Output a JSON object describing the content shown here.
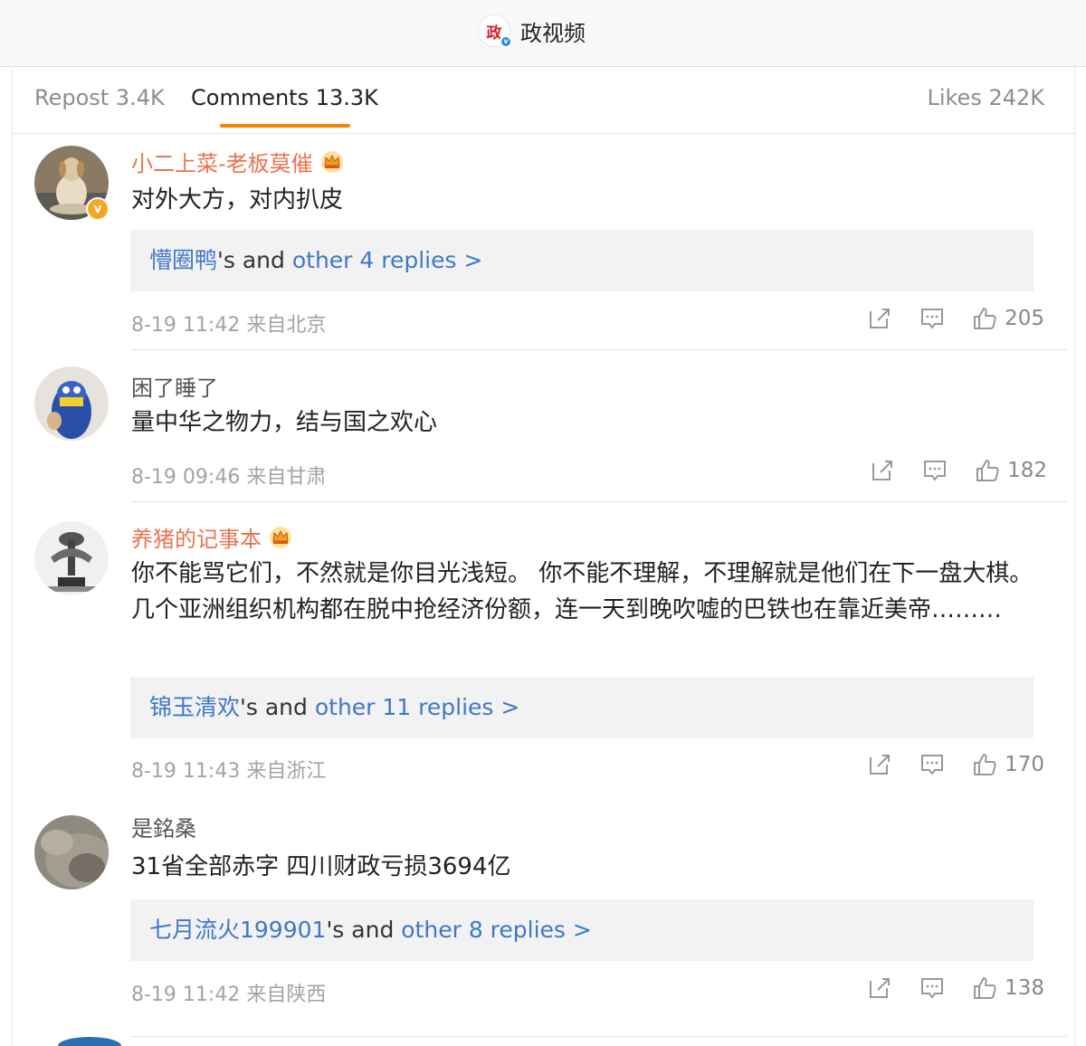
{
  "header": {
    "logo_glyph": "政",
    "account_name": "政视频",
    "verified_mark": "v",
    "brand_color": "#d6202b"
  },
  "tabs": [
    {
      "label": "Repost 3.4K"
    },
    {
      "label": "Comments 13.3K"
    },
    {
      "label": "Likes 242K"
    }
  ],
  "accent_color": "#ff8200",
  "link_color": "#3f78c8",
  "comments": [
    {
      "username": "小二上菜-老板莫催",
      "username_style": "vip-orange",
      "verified": true,
      "verified_mark": "v",
      "text": "对外大方，对内扒皮",
      "replies": {
        "user": "懵圈鸭",
        "mid": "'s and ",
        "more": "other 4 replies >"
      },
      "time": "8-19 11:42",
      "location": "来自北京",
      "likes": "205"
    },
    {
      "username": "困了睡了",
      "username_style": "plain",
      "verified": false,
      "text": "量中华之物力，结与国之欢心",
      "replies": null,
      "time": "8-19 09:46",
      "location": "来自甘肃",
      "likes": "182"
    },
    {
      "username": "养猪的记事本",
      "username_style": "vip-orange",
      "verified": false,
      "text": "你不能骂它们，不然就是你目光浅短。 你不能不理解，不理解就是他们在下一盘大棋。 几个亚洲组织机构都在脱中抢经济份额，连一天到晚吹嘘的巴铁也在靠近美帝………",
      "replies": {
        "user": "锦玉清欢",
        "mid": "'s and ",
        "more": "other 11 replies >"
      },
      "time": "8-19 11:43",
      "location": "来自浙江",
      "likes": "170"
    },
    {
      "username": "是銘桑",
      "username_style": "plain",
      "verified": false,
      "text": "31省全部赤字 四川财政亏损3694亿",
      "replies": {
        "user": "七月流火199901",
        "mid": "'s and ",
        "more": "other 8 replies >"
      },
      "time": "8-19 11:42",
      "location": "来自陕西",
      "likes": "138"
    }
  ]
}
